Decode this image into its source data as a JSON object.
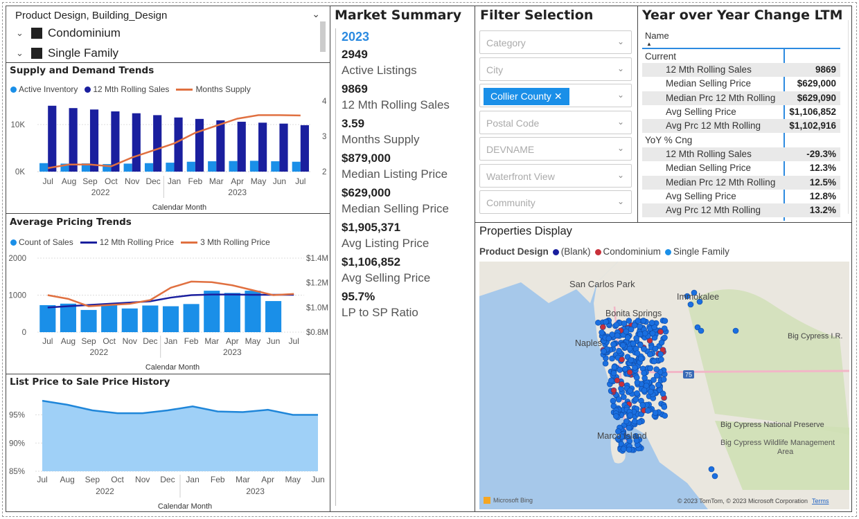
{
  "slicer": {
    "header": "Product Design, Building_Design",
    "items": [
      "Condominium",
      "Single Family"
    ]
  },
  "supply": {
    "title": "Supply and Demand Trends",
    "legend": [
      "Active Inventory",
      "12 Mth Rolling Sales",
      "Months Supply"
    ],
    "xlabel": "Calendar Month",
    "months": [
      "Jul",
      "Aug",
      "Sep",
      "Oct",
      "Nov",
      "Dec",
      "Jan",
      "Feb",
      "Mar",
      "Apr",
      "May",
      "Jun",
      "Jul"
    ],
    "years": [
      "2022",
      "2023"
    ],
    "yticks_left": [
      "10K",
      "0K"
    ],
    "yticks_right": [
      "4",
      "3",
      "2"
    ]
  },
  "pricing": {
    "title": "Average Pricing Trends",
    "legend": [
      "Count of Sales",
      "12 Mth Rolling Price",
      "3 Mth Rolling Price"
    ],
    "xlabel": "Calendar Month",
    "months": [
      "Jul",
      "Aug",
      "Sep",
      "Oct",
      "Nov",
      "Dec",
      "Jan",
      "Feb",
      "Mar",
      "Apr",
      "May",
      "Jun",
      "Jul"
    ],
    "years": [
      "2022",
      "2023"
    ],
    "yticks_left": [
      "2000",
      "1000",
      "0"
    ],
    "yticks_right": [
      "$1.4M",
      "$1.2M",
      "$1.0M",
      "$0.8M"
    ]
  },
  "lpsp": {
    "title": "List Price to Sale Price History",
    "xlabel": "Calendar Month",
    "months": [
      "Jul",
      "Aug",
      "Sep",
      "Oct",
      "Nov",
      "Dec",
      "Jan",
      "Feb",
      "Mar",
      "Apr",
      "May",
      "Jun"
    ],
    "years": [
      "2022",
      "2023"
    ],
    "yticks": [
      "95%",
      "90%",
      "85%"
    ]
  },
  "market": {
    "title": "Market Summary",
    "year": "2023",
    "stats": [
      {
        "value": "2949",
        "label": "Active Listings"
      },
      {
        "value": "9869",
        "label": "12 Mth Rolling Sales"
      },
      {
        "value": "3.59",
        "label": "Months Supply"
      },
      {
        "value": "$879,000",
        "label": "Median Listing Price"
      },
      {
        "value": "$629,000",
        "label": "Median Selling Price"
      },
      {
        "value": "$1,905,371",
        "label": "Avg Listing Price"
      },
      {
        "value": "$1,106,852",
        "label": "Avg Selling Price"
      },
      {
        "value": "95.7%",
        "label": "LP to SP Ratio"
      }
    ]
  },
  "filters": {
    "title": "Filter Selection",
    "items": [
      "Category",
      "City",
      "Collier County",
      "Postal Code",
      "DEVNAME",
      "Waterfront View",
      "Community"
    ]
  },
  "yoy": {
    "title": "Year over Year Change LTM",
    "col_header": "Name",
    "section1": "Current",
    "rows1": [
      {
        "name": "12 Mth Rolling Sales",
        "value": "9869"
      },
      {
        "name": "Median Selling Price",
        "value": "$629,000"
      },
      {
        "name": "Median Prc 12 Mth Rolling",
        "value": "$629,090"
      },
      {
        "name": "Avg Selling Price",
        "value": "$1,106,852"
      },
      {
        "name": "Avg Prc 12 Mth Rolling",
        "value": "$1,102,916"
      }
    ],
    "section2": "YoY % Cng",
    "rows2": [
      {
        "name": "12 Mth Rolling Sales",
        "value": "-29.3%"
      },
      {
        "name": "Median Selling Price",
        "value": "12.3%"
      },
      {
        "name": "Median Prc 12 Mth Rolling",
        "value": "12.5%"
      },
      {
        "name": "Avg Selling Price",
        "value": "12.8%"
      },
      {
        "name": "Avg Prc 12 Mth Rolling",
        "value": "13.2%"
      }
    ]
  },
  "map": {
    "title": "Properties Display",
    "legend_label": "Product Design",
    "legend": [
      "(Blank)",
      "Condominium",
      "Single Family"
    ],
    "places": [
      "San Carlos Park",
      "Immokalee",
      "Bonita Springs",
      "Naples",
      "Big Cypress I.R.",
      "Big Cypress National Preserve",
      "Big Cypress Wildlife Management Area",
      "Marco Island"
    ],
    "road": "75",
    "brand": "Microsoft Bing",
    "copyright": "© 2023 TomTom, © 2023 Microsoft Corporation",
    "terms": "Terms"
  },
  "colors": {
    "light_blue": "#1a8fe8",
    "dark_blue": "#1a1f9e",
    "orange": "#e07040",
    "area_fill": "#9fd0f7",
    "area_line": "#1f86d9",
    "year_accent": "#2b8ae0"
  },
  "chart_data": [
    {
      "type": "bar",
      "title": "Supply and Demand Trends",
      "xlabel": "Calendar Month",
      "categories": [
        "Jul 2022",
        "Aug 2022",
        "Sep 2022",
        "Oct 2022",
        "Nov 2022",
        "Dec 2022",
        "Jan 2023",
        "Feb 2023",
        "Mar 2023",
        "Apr 2023",
        "May 2023",
        "Jun 2023",
        "Jul 2023"
      ],
      "series": [
        {
          "name": "Active Inventory",
          "values": [
            1800,
            1700,
            1750,
            1600,
            1700,
            1800,
            1900,
            2100,
            2200,
            2250,
            2300,
            2200,
            2100
          ]
        },
        {
          "name": "12 Mth Rolling Sales",
          "values": [
            14000,
            13500,
            13200,
            12800,
            12400,
            12000,
            11500,
            11200,
            10900,
            10600,
            10400,
            10200,
            9869
          ]
        },
        {
          "name": "Months Supply",
          "values": [
            2.1,
            2.2,
            2.2,
            2.15,
            2.4,
            2.6,
            2.8,
            3.1,
            3.3,
            3.5,
            3.6,
            3.6,
            3.59
          ]
        }
      ],
      "ylim_left": [
        0,
        15000
      ],
      "ylim_right": [
        2,
        4
      ]
    },
    {
      "type": "bar",
      "title": "Average Pricing Trends",
      "xlabel": "Calendar Month",
      "categories": [
        "Jul 2022",
        "Aug 2022",
        "Sep 2022",
        "Oct 2022",
        "Nov 2022",
        "Dec 2022",
        "Jan 2023",
        "Feb 2023",
        "Mar 2023",
        "Apr 2023",
        "May 2023",
        "Jun 2023",
        "Jul 2023"
      ],
      "series": [
        {
          "name": "Count of Sales",
          "values": [
            730,
            770,
            600,
            740,
            640,
            720,
            700,
            760,
            1120,
            1060,
            1120,
            840,
            null
          ]
        },
        {
          "name": "12 Mth Rolling Price",
          "values": [
            1000000,
            1010000,
            1020000,
            1030000,
            1040000,
            1050000,
            1080000,
            1100000,
            1105000,
            1105000,
            1103000,
            1103000,
            1102916
          ]
        },
        {
          "name": "3 Mth Rolling Price",
          "values": [
            1100000,
            1070000,
            1010000,
            1020000,
            1030000,
            1060000,
            1160000,
            1210000,
            1205000,
            1180000,
            1140000,
            1100000,
            1110000
          ]
        }
      ],
      "ylim_left": [
        0,
        2000
      ],
      "ylim_right": [
        800000,
        1400000
      ]
    },
    {
      "type": "area",
      "title": "List Price to Sale Price History",
      "xlabel": "Calendar Month",
      "categories": [
        "Jul 2022",
        "Aug 2022",
        "Sep 2022",
        "Oct 2022",
        "Nov 2022",
        "Dec 2022",
        "Jan 2023",
        "Feb 2023",
        "Mar 2023",
        "Apr 2023",
        "May 2023",
        "Jun 2023"
      ],
      "series": [
        {
          "values": [
            97.5,
            96.8,
            95.8,
            95.3,
            95.3,
            95.8,
            96.5,
            95.6,
            95.5,
            95.9,
            95.0,
            95.0
          ]
        }
      ],
      "ylim": [
        85,
        98.5
      ]
    }
  ]
}
